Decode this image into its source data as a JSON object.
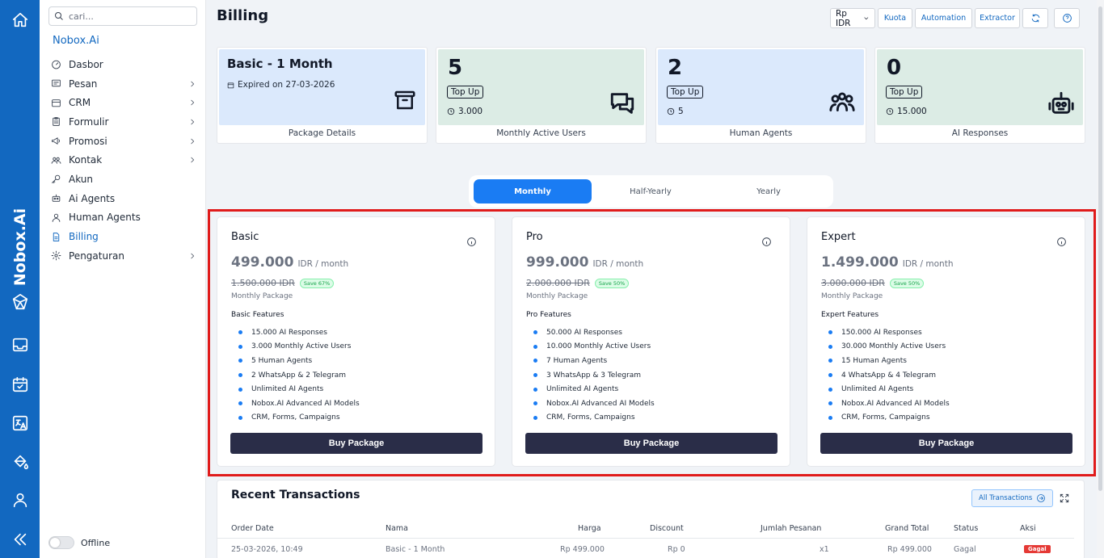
{
  "rail": {
    "brand": "Nobox.Ai",
    "icons": [
      "home-icon",
      "inbox-icon",
      "calendar-check-icon",
      "translate-icon",
      "paint-bucket-icon",
      "user-icon",
      "collapse-icon"
    ]
  },
  "sidebar": {
    "search_placeholder": "cari...",
    "title": "Nobox.Ai",
    "items": [
      {
        "label": "Dasbor",
        "icon": "dashboard-icon",
        "chevron": false
      },
      {
        "label": "Pesan",
        "icon": "message-icon",
        "chevron": true
      },
      {
        "label": "CRM",
        "icon": "crm-icon",
        "chevron": true
      },
      {
        "label": "Formulir",
        "icon": "clipboard-icon",
        "chevron": true
      },
      {
        "label": "Promosi",
        "icon": "megaphone-icon",
        "chevron": true
      },
      {
        "label": "Kontak",
        "icon": "contacts-icon",
        "chevron": true
      },
      {
        "label": "Akun",
        "icon": "key-icon",
        "chevron": false
      },
      {
        "label": "Ai Agents",
        "icon": "robot-icon",
        "chevron": false
      },
      {
        "label": "Human Agents",
        "icon": "person-icon",
        "chevron": false
      },
      {
        "label": "Billing",
        "icon": "document-icon",
        "chevron": false,
        "active": true
      },
      {
        "label": "Pengaturan",
        "icon": "gear-icon",
        "chevron": true
      }
    ],
    "offline_label": "Offline"
  },
  "header": {
    "title": "Billing",
    "currency": "Rp IDR",
    "buttons": [
      "Kuota",
      "Automation",
      "Extractor"
    ]
  },
  "stats": {
    "package": {
      "title": "Basic - 1 Month",
      "expired": "Expired on 27-03-2026",
      "caption": "Package Details"
    },
    "mau": {
      "value": "5",
      "topup": "Top Up",
      "quota": "3.000",
      "caption": "Monthly Active Users"
    },
    "human": {
      "value": "2",
      "topup": "Top Up",
      "quota": "5",
      "caption": "Human Agents"
    },
    "ai": {
      "value": "0",
      "topup": "Top Up",
      "quota": "15.000",
      "caption": "AI Responses"
    }
  },
  "periods": [
    "Monthly",
    "Half-Yearly",
    "Yearly"
  ],
  "plans": [
    {
      "name": "Basic",
      "price": "499.000",
      "unit": "IDR / month",
      "old_price": "1.500.000 IDR",
      "save": "Save 67%",
      "package_label": "Monthly Package",
      "features_title": "Basic Features",
      "features": [
        "15.000 AI Responses",
        "3.000 Monthly Active Users",
        "5 Human Agents",
        "2 WhatsApp & 2 Telegram",
        "Unlimited AI Agents",
        "Nobox.AI Advanced AI Models",
        "CRM, Forms, Campaigns"
      ],
      "button": "Buy Package"
    },
    {
      "name": "Pro",
      "price": "999.000",
      "unit": "IDR / month",
      "old_price": "2.000.000 IDR",
      "save": "Save 50%",
      "package_label": "Monthly Package",
      "features_title": "Pro Features",
      "features": [
        "50.000 AI Responses",
        "10.000 Monthly Active Users",
        "7 Human Agents",
        "3 WhatsApp & 3 Telegram",
        "Unlimited AI Agents",
        "Nobox.AI Advanced AI Models",
        "CRM, Forms, Campaigns"
      ],
      "button": "Buy Package"
    },
    {
      "name": "Expert",
      "price": "1.499.000",
      "unit": "IDR / month",
      "old_price": "3.000.000 IDR",
      "save": "Save 50%",
      "package_label": "Monthly Package",
      "features_title": "Expert Features",
      "features": [
        "150.000 AI Responses",
        "30.000 Monthly Active Users",
        "15 Human Agents",
        "4 WhatsApp & 4 Telegram",
        "Unlimited AI Agents",
        "Nobox.AI Advanced AI Models",
        "CRM, Forms, Campaigns"
      ],
      "button": "Buy Package"
    }
  ],
  "transactions": {
    "title": "Recent Transactions",
    "all_button": "All Transactions",
    "columns": [
      "Order Date",
      "Nama",
      "Harga",
      "Discount",
      "Jumlah Pesanan",
      "Grand Total",
      "Status",
      "Aksi"
    ],
    "rows": [
      [
        "25-03-2026, 10:49",
        "Basic - 1 Month",
        "Rp 499.000",
        "Rp 0",
        "x1",
        "Rp 499.000",
        "Gagal",
        "Gagal"
      ]
    ]
  }
}
